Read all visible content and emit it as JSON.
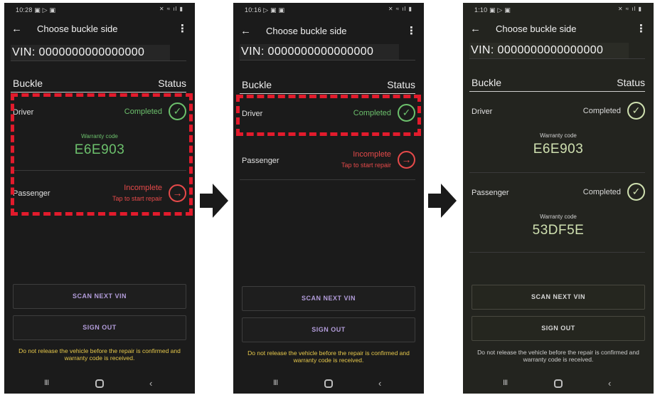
{
  "panels": [
    {
      "time": "10:28",
      "status_icons": "▣ ▷ ▣",
      "sys_icons": "✕ ≈ ıl ▮",
      "title": "Choose buckle side",
      "vin": "VIN: 0000000000000000",
      "buckle_header": "Buckle",
      "status_header": "Status",
      "rows": [
        {
          "side": "Driver",
          "state": "Completed",
          "state_kind": "completed",
          "warranty_label": "Warranty code",
          "warranty_code": "E6E903"
        },
        {
          "side": "Passenger",
          "state": "Incomplete",
          "state_kind": "incomplete",
          "sub": "Tap to start repair"
        }
      ],
      "scan_button": "SCAN NEXT VIN",
      "signout_button": "SIGN OUT",
      "note": "Do not release the vehicle before the repair is confirmed and warranty code is received."
    },
    {
      "time": "10:16",
      "status_icons": "▷ ▣ ▣",
      "sys_icons": "✕ ≈ ıl ▮",
      "title": "Choose buckle side",
      "vin": "VIN: 0000000000000000",
      "buckle_header": "Buckle",
      "status_header": "Status",
      "rows": [
        {
          "side": "Driver",
          "state": "Completed",
          "state_kind": "completed"
        },
        {
          "side": "Passenger",
          "state": "Incomplete",
          "state_kind": "incomplete",
          "sub": "Tap to start repair"
        }
      ],
      "scan_button": "SCAN NEXT VIN",
      "signout_button": "SIGN OUT",
      "note": "Do not release the vehicle before the repair is confirmed and warranty code is received."
    },
    {
      "time": "1:10",
      "status_icons": "▣ ▷ ▣",
      "sys_icons": "✕ ≈ ıl ▮",
      "title": "Choose buckle side",
      "vin": "VIN: 0000000000000000",
      "buckle_header": "Buckle",
      "status_header": "Status",
      "rows": [
        {
          "side": "Driver",
          "state": "Completed",
          "state_kind": "completed",
          "warranty_label": "Warranty code",
          "warranty_code": "E6E903"
        },
        {
          "side": "Passenger",
          "state": "Completed",
          "state_kind": "completed",
          "warranty_label": "Warranty code",
          "warranty_code": "53DF5E"
        }
      ],
      "scan_button": "SCAN NEXT VIN",
      "signout_button": "SIGN OUT",
      "note": "Do not release the vehicle before the repair is confirmed and warranty code is received."
    }
  ],
  "icons": {
    "back": "arrow-left-icon",
    "menu": "more-vert-icon",
    "completed": "check-circle-icon",
    "incomplete": "arrow-right-circle-icon",
    "step_arrow": "black-arrow-right-icon"
  },
  "colors": {
    "completed_green": "#6cc06c",
    "incomplete_red": "#e64a4a",
    "highlight_dash": "#e21b2c",
    "button_text_purple": "#b39ddb",
    "note_yellow": "#e6c84b"
  }
}
